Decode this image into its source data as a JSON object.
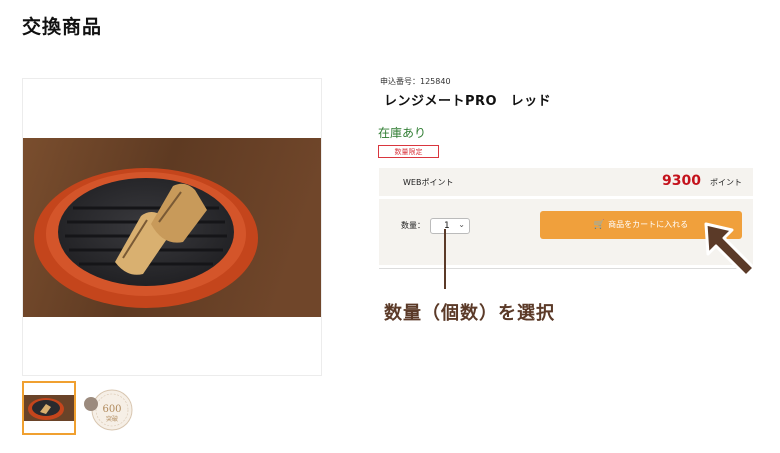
{
  "page": {
    "title": "交換商品"
  },
  "product": {
    "order_number": "申込番号：125840",
    "name": "レンジメートPRO　レッド",
    "stock_status": "在庫あり",
    "badge": "数量限定"
  },
  "points": {
    "label": "WEBポイント",
    "value": "9300",
    "unit": "ポイント"
  },
  "cart": {
    "qty_label": "数量：",
    "qty_value": "1",
    "button_label": "商品をカートに入れる"
  },
  "annotation": {
    "text": "数量（個数）を選択"
  },
  "thumbnails": {
    "badge_number": "600",
    "badge_text": "突破"
  },
  "colors": {
    "accent": "#f0a03c",
    "price": "#c4121c",
    "stock": "#2f7d32",
    "annotation": "#5b3a28"
  },
  "icons": [
    "cart-icon",
    "chevron-down-icon",
    "pointer-arrow-icon"
  ]
}
